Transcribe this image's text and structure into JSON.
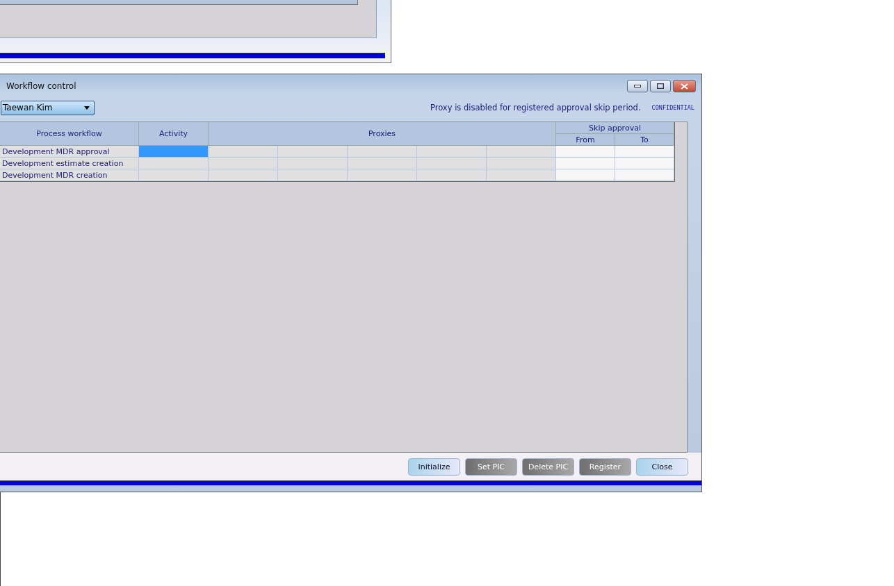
{
  "window": {
    "title": "Workflow control"
  },
  "user_select": {
    "value": "Taewan Kim"
  },
  "notice": "Proxy is disabled for registered approval skip period.",
  "classification": "CONFIDENTIAL",
  "table": {
    "columns": {
      "process": "Process workflow",
      "activity": "Activity",
      "proxies": "Proxies",
      "skip": "Skip approval",
      "from": "From",
      "to": "To"
    },
    "rows": [
      {
        "process": "Development MDR approval",
        "activity_selected": true
      },
      {
        "process": "Development estimate creation",
        "activity_selected": false
      },
      {
        "process": "Development MDR creation",
        "activity_selected": false
      }
    ]
  },
  "buttons": [
    {
      "label": "Initialize",
      "disabled": false
    },
    {
      "label": "Set PIC",
      "disabled": true
    },
    {
      "label": "Delete PIC",
      "disabled": true
    },
    {
      "label": "Register",
      "disabled": true
    },
    {
      "label": "Close",
      "disabled": false
    }
  ]
}
